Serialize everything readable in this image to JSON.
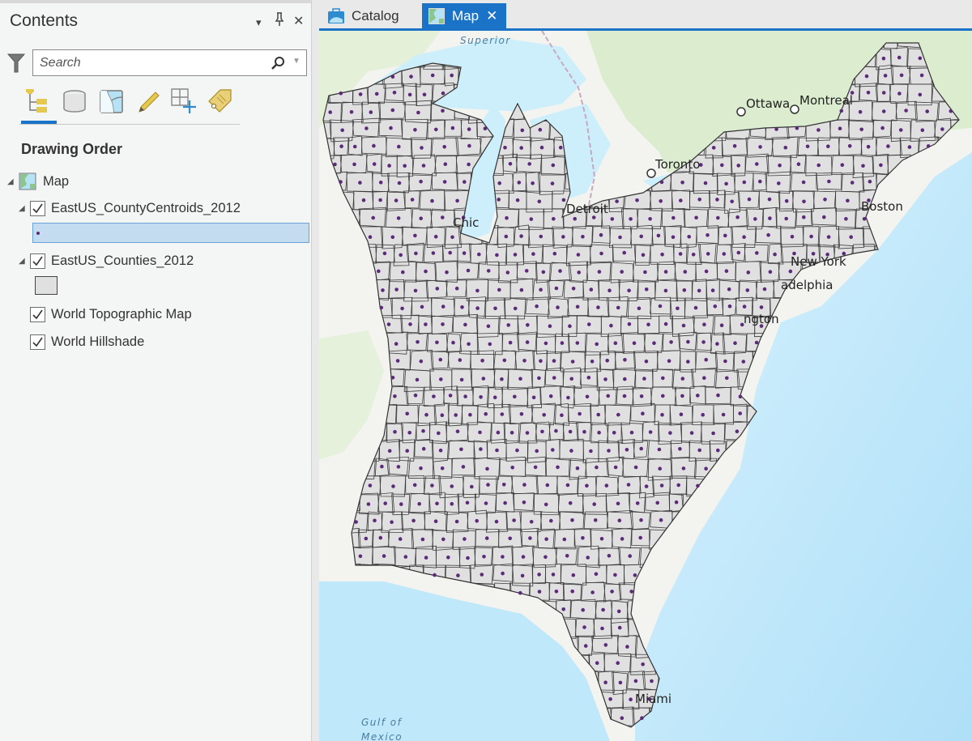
{
  "contents_pane": {
    "title": "Contents",
    "controls": {
      "menu": "▾",
      "pin": "pin-icon",
      "close": "✕"
    },
    "search": {
      "placeholder": "Search",
      "value": ""
    },
    "view_tabs": [
      {
        "name": "list-by-drawing-order",
        "icon": "drawing-order-icon",
        "active": true
      },
      {
        "name": "list-by-data-source",
        "icon": "database-icon",
        "active": false
      },
      {
        "name": "list-by-selection",
        "icon": "selection-map-icon",
        "active": false
      },
      {
        "name": "list-by-editing",
        "icon": "pencil-icon",
        "active": false
      },
      {
        "name": "list-by-snapping",
        "icon": "snapping-grid-icon",
        "active": false
      },
      {
        "name": "list-by-labeling",
        "icon": "label-tag-icon",
        "active": false
      }
    ],
    "section_title": "Drawing Order",
    "tree": {
      "map_label": "Map",
      "layers": [
        {
          "name": "EastUS_CountyCentroids_2012",
          "checked": true,
          "expanded": true,
          "symbol": "point",
          "symbol_color": "#5b2a78",
          "selected_symbol": true
        },
        {
          "name": "EastUS_Counties_2012",
          "checked": true,
          "expanded": true,
          "symbol": "polygon",
          "symbol_color": "#e0e0e0"
        },
        {
          "name": "World Topographic Map",
          "checked": true
        },
        {
          "name": "World Hillshade",
          "checked": true
        }
      ]
    }
  },
  "tabs": [
    {
      "label": "Catalog",
      "icon": "catalog-icon",
      "active": false
    },
    {
      "label": "Map",
      "icon": "map-icon",
      "active": true,
      "closable": true,
      "close_glyph": "✕"
    }
  ],
  "map": {
    "city_labels": [
      "Ottawa",
      "Montreal",
      "Toronto",
      "Detroit",
      "Chic",
      "Boston",
      "New York",
      "adelphia",
      "ngton",
      "Miami"
    ],
    "water_labels": [
      "Superior",
      "Gulf of",
      "Mexico"
    ],
    "colors": {
      "county_fill": "#e1e0e1",
      "county_outline": "#3c3c3c",
      "centroid": "#5b2a78",
      "water": "#cdeffc",
      "ocean": "#b8e4fa",
      "land_green": "#dbeccf",
      "land": "#f4f4f0",
      "accent": "#1a73c7"
    }
  }
}
